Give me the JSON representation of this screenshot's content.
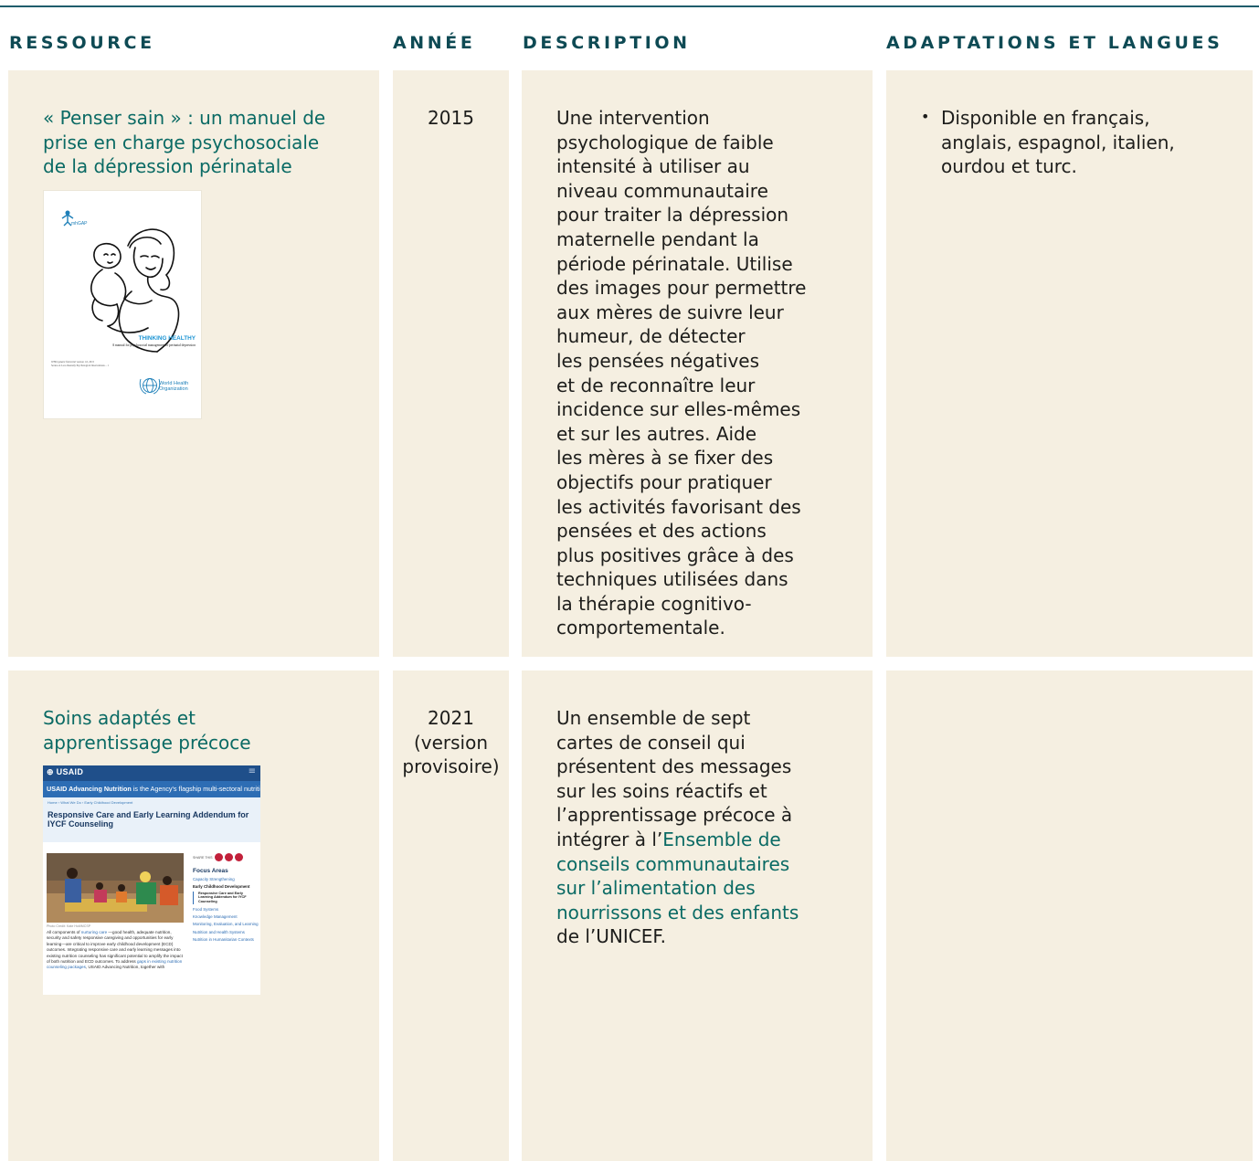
{
  "headers": {
    "resource": "RESSOURCE",
    "year": "ANNÉE",
    "description": "DESCRIPTION",
    "adaptations": "ADAPTATIONS ET LANGUES"
  },
  "rows": [
    {
      "resource_title": [
        "« Penser sain » : un manuel de",
        "prise en charge psychosociale",
        "de la dépression périnatale"
      ],
      "cover": {
        "logo_text": "mhGAP",
        "title": "THINKING HEALTHY",
        "subtitle": "A manual for psychosocial management of perinatal depression",
        "series_line1": "WHO generic field-trial version 1.0, 2015",
        "series_line2": "Series on Low-Intensity Psychological Interventions – 1",
        "org_line1": "World Health",
        "org_line2": "Organization"
      },
      "year": [
        "2015"
      ],
      "description": [
        "Une intervention",
        "psychologique de faible",
        "intensité à utiliser au",
        "niveau communautaire",
        "pour traiter la dépression",
        "maternelle pendant la",
        "période périnatale. Utilise",
        "des images pour permettre",
        "aux mères de suivre leur",
        "humeur, de détecter",
        "les pensées négatives",
        "et de reconnaître leur",
        "incidence sur elles-mêmes",
        "et sur les autres. Aide",
        "les mères à se fixer des",
        "objectifs pour pratiquer",
        "les activités favorisant des",
        "pensées et des actions",
        "plus positives grâce à des",
        "techniques utilisées dans",
        "la thérapie cognitivo-",
        "comportementale."
      ],
      "adaptations": [
        "Disponible en français,",
        "anglais, espagnol, italien,",
        "ourdou et turc."
      ]
    },
    {
      "resource_title": [
        "Soins adaptés et",
        "apprentissage précoce"
      ],
      "cover": {
        "logo_text": "USAID",
        "band_bold": "USAID Advancing Nutrition",
        "band_rest": " is the Agency's flagship multi-sectoral nutrition project.",
        "menu_icon": "≡",
        "breadcrumb": "Home › What We Do › Early Childhood Development",
        "page_title": "Responsive Care and Early Learning Addendum for IYCF Counseling",
        "photo_credit": "Photo Credit: Kate Holt/MCSP",
        "para_1": "All components of ",
        "para_link_1": "nurturing care",
        "para_2": " —good health, adequate nutrition, security and safety responsive caregiving and opportunities for early learning—are critical to improve early childhood development (ECD) outcomes. Integrating responsive care and early learning messages into existing nutrition counseling has significant potential to amplify the impact of both nutrition and ECD outcomes. To address ",
        "para_link_2": "gaps in existing nutrition counseling packages",
        "para_3": ", USAID Advancing Nutrition, together with",
        "share_label": "SHARE THIS",
        "focus_heading": "Focus Areas",
        "focus_1": "Capacity Strengthening",
        "focus_current": "Early Childhood Development",
        "focus_sub": "Responsive Care and Early Learning Addendum for IYCF Counseling",
        "focus_2": "Food Systems",
        "focus_3": "Knowledge Management",
        "focus_4": "Monitoring, Evaluation, and Learning",
        "focus_5": "Nutrition and Health Systems",
        "focus_6": "Nutrition in Humanitarian Contexts"
      },
      "year": [
        "2021",
        "(version",
        "provisoire)"
      ],
      "description_plain_a": [
        "Un ensemble de sept",
        "cartes de conseil qui",
        "présentent des messages",
        "sur les soins réactifs et",
        "l’apprentissage précoce à"
      ],
      "description_prefix": "intégrer à l’",
      "description_link": [
        "Ensemble de",
        "conseils communautaires",
        "sur l’alimentation des",
        "nourrissons et des enfants"
      ],
      "description_suffix": "de l’UNICEF."
    }
  ],
  "colors": {
    "cell_bg": "#f5efe1",
    "header_text": "#0e4a54",
    "teal_text": "#0a6a64",
    "rule": "#1f5c6b"
  }
}
